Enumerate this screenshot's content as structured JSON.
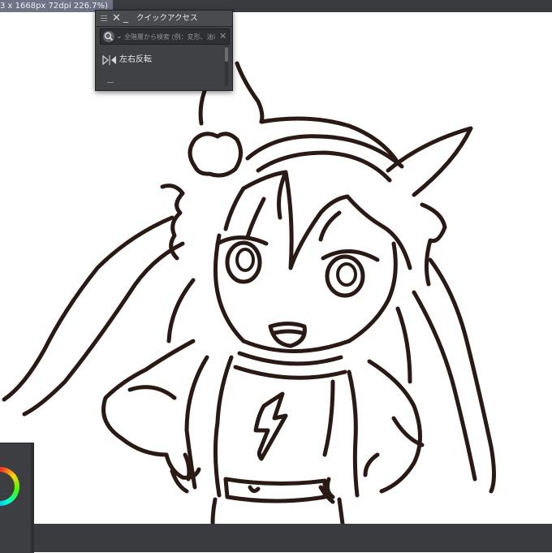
{
  "document": {
    "tab_label": "3 x 1668px 72dpi 226.7%)"
  },
  "quick_access": {
    "title": "クイックアクセス",
    "search_placeholder": "全階層から検索 (例：変形、油彩",
    "items": [
      {
        "label": "左右反転",
        "icon": "flip-horizontal-icon"
      }
    ]
  },
  "colors": {
    "toolbar_bg": "#3a3b3e",
    "tab_bg": "#6f7385",
    "panel_bg": "#404144",
    "canvas_bg": "#ffffff",
    "line_color": "#2a1a16"
  },
  "icons": [
    "menu-grip-icon",
    "close-icon",
    "minimize-icon",
    "search-icon",
    "chevron-down-icon",
    "clear-icon",
    "flip-horizontal-icon",
    "color-wheel-icon"
  ]
}
